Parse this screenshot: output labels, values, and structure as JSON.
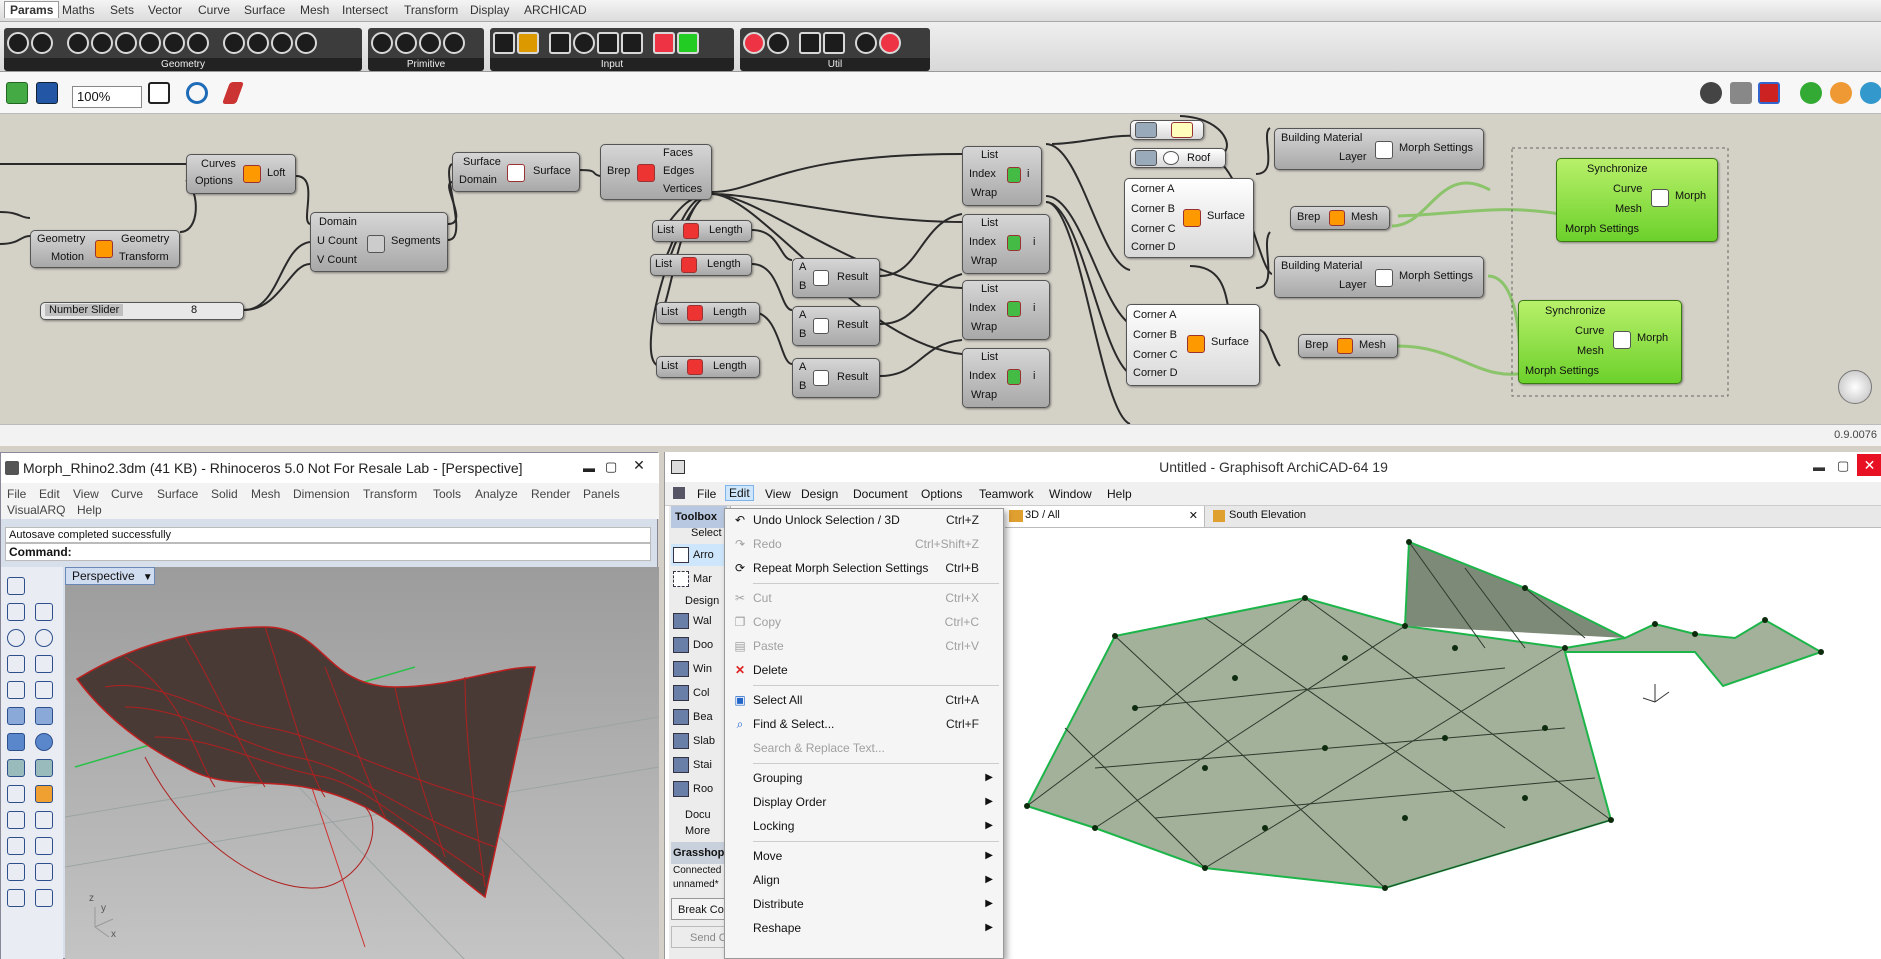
{
  "grasshopper": {
    "tabs": [
      "Params",
      "Maths",
      "Sets",
      "Vector",
      "Curve",
      "Surface",
      "Mesh",
      "Intersect",
      "Transform",
      "Display",
      "ARCHICAD"
    ],
    "active_tab": "Params",
    "ribbon_groups": [
      "Geometry",
      "Primitive",
      "Input",
      "Util"
    ],
    "zoom": "100%",
    "nodes": {
      "loft": {
        "inputs": [
          "Curves",
          "Options"
        ],
        "name": "Loft"
      },
      "transform": {
        "inputs": [
          "Geometry",
          "Motion"
        ],
        "outputs": [
          "Geometry",
          "Transform"
        ]
      },
      "slider": {
        "label": "Number Slider",
        "value": "8"
      },
      "segments": {
        "inputs": [
          "Domain",
          "U Count",
          "V Count"
        ],
        "name": "Segments"
      },
      "surface_param": {
        "inputs": [
          "Surface",
          "Domain"
        ],
        "name": "Surface"
      },
      "brep": {
        "input": "Brep",
        "outputs": [
          "Faces",
          "Edges",
          "Vertices"
        ]
      },
      "length": {
        "input": "List",
        "name": "Length"
      },
      "result": {
        "inputs": [
          "A",
          "B"
        ],
        "name": "Result"
      },
      "listitem": {
        "inputs": [
          "List",
          "Index",
          "Wrap"
        ],
        "output": "i"
      },
      "surface4": {
        "inputs": [
          "Corner A",
          "Corner B",
          "Corner C",
          "Corner D"
        ],
        "name": "Surface"
      },
      "roof": "Roof",
      "building_material": {
        "inputs": [
          "Building Material",
          "Layer"
        ],
        "name": "Morph Settings"
      },
      "mesh": {
        "input": "Brep",
        "name": "Mesh"
      },
      "morph": {
        "inputs": [
          "Synchronize",
          "Curve",
          "Mesh",
          "Morph Settings"
        ],
        "name": "Morph"
      }
    },
    "status_right": "0.9.0076"
  },
  "rhino": {
    "title": "Morph_Rhino2.3dm (41 KB) - Rhinoceros 5.0 Not For Resale Lab - [Perspective]",
    "menu": [
      "File",
      "Edit",
      "View",
      "Curve",
      "Surface",
      "Solid",
      "Mesh",
      "Dimension",
      "Transform",
      "Tools",
      "Analyze",
      "Render",
      "Panels"
    ],
    "menu2": [
      "VisualARQ",
      "Help"
    ],
    "history": "Autosave completed successfully",
    "command_label": "Command:",
    "viewport_tab": "Perspective",
    "axis_x": "x",
    "axis_y": "y",
    "axis_z": "z"
  },
  "archicad": {
    "title": "Untitled - Graphisoft ArchiCAD-64 19",
    "menu": [
      "File",
      "Edit",
      "View",
      "Design",
      "Document",
      "Options",
      "Teamwork",
      "Window",
      "Help"
    ],
    "selected_menu": "Edit",
    "toolbox": {
      "title": "Toolbox",
      "select": "Select",
      "items": [
        "Arro",
        "Mar",
        "Design",
        "Wal",
        "Doo",
        "Win",
        "Col",
        "Bea",
        "Slab",
        "Stai",
        "Roo",
        "Docu",
        "More"
      ],
      "grasshopper": "Grasshop",
      "connected": "Connected",
      "unnamed": "unnamed*",
      "break": "Break Co",
      "send": "Send C"
    },
    "tabs": [
      "3D / All",
      "South Elevation"
    ],
    "edit_menu": [
      {
        "label": "Undo Unlock Selection / 3D",
        "key": "Ctrl+Z",
        "enabled": true
      },
      {
        "label": "Redo",
        "key": "Ctrl+Shift+Z",
        "enabled": false
      },
      {
        "label": "Repeat Morph Selection Settings",
        "key": "Ctrl+B",
        "enabled": true
      },
      {
        "label": "Cut",
        "key": "Ctrl+X",
        "enabled": false
      },
      {
        "label": "Copy",
        "key": "Ctrl+C",
        "enabled": false
      },
      {
        "label": "Paste",
        "key": "Ctrl+V",
        "enabled": false
      },
      {
        "label": "Delete",
        "key": "",
        "enabled": true
      },
      {
        "label": "Select All",
        "key": "Ctrl+A",
        "enabled": true
      },
      {
        "label": "Find & Select...",
        "key": "Ctrl+F",
        "enabled": true
      },
      {
        "label": "Search & Replace Text...",
        "key": "",
        "enabled": false
      },
      {
        "label": "Grouping",
        "submenu": true
      },
      {
        "label": "Display Order",
        "submenu": true
      },
      {
        "label": "Locking",
        "submenu": true
      },
      {
        "label": "Move",
        "submenu": true
      },
      {
        "label": "Align",
        "submenu": true
      },
      {
        "label": "Distribute",
        "submenu": true
      },
      {
        "label": "Reshape",
        "submenu": true
      }
    ]
  }
}
